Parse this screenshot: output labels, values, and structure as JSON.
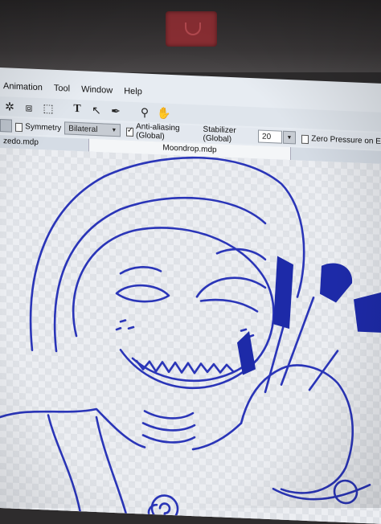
{
  "menu": [
    "Animation",
    "Tool",
    "Window",
    "Help"
  ],
  "toolbar_icons": [
    "magic-wand-icon",
    "crop-icon",
    "transform-icon",
    "text-icon",
    "select-icon",
    "pen-icon",
    "eyedropper-icon",
    "hand-icon"
  ],
  "options": {
    "symmetry_label": "Symmetry",
    "symmetry_value": "Bilateral",
    "antialias_label": "Anti-aliasing (Global)",
    "stabilizer_label": "Stabilizer (Global)",
    "stabilizer_value": "20",
    "zero_pressure_label": "Zero Pressure on E"
  },
  "tabs": {
    "inactive": "zedo.mdp",
    "active": "Moondrop.mdp"
  },
  "colors": {
    "ink": "#2a35b8",
    "fill": "#1d2aa8"
  }
}
